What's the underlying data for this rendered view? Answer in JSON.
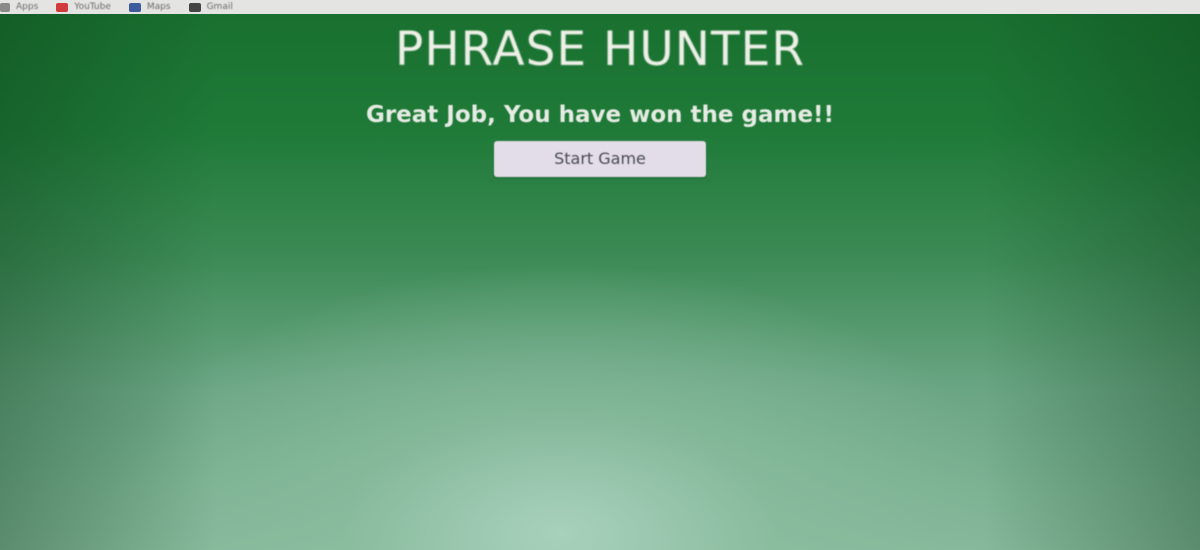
{
  "browser": {
    "bookmarks": [
      {
        "label": "Apps",
        "icon": "apps-grid-icon",
        "color": "#7a7a7a"
      },
      {
        "label": "YouTube",
        "icon": "youtube-icon",
        "color": "#d23b3b"
      },
      {
        "label": "Maps",
        "icon": "maps-icon",
        "color": "#3b5b9c"
      },
      {
        "label": "Gmail",
        "icon": "gmail-icon",
        "color": "#444444"
      }
    ]
  },
  "game": {
    "title": "PHRASE HUNTER",
    "message": "Great Job, You have won the game!!",
    "start_button_label": "Start Game"
  },
  "colors": {
    "win_background": "#1d7a3a",
    "title_text": "#eef0e8",
    "button_background": "#e2dde8"
  }
}
